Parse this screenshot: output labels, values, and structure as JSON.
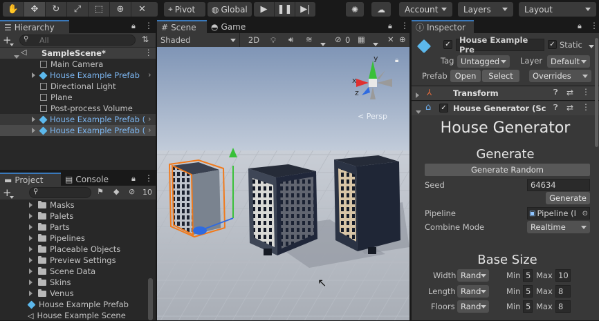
{
  "toolbar": {
    "pivot_label": "Pivot",
    "global_label": "Global",
    "account_label": "Account",
    "layers_label": "Layers",
    "layout_label": "Layout"
  },
  "hierarchy": {
    "tab_label": "Hierarchy",
    "search_placeholder": "All",
    "scene_name": "SampleScene*",
    "items": [
      {
        "label": "Main Camera",
        "prefab": false
      },
      {
        "label": "House Example Prefab",
        "prefab": true
      },
      {
        "label": "Directional Light",
        "prefab": false
      },
      {
        "label": "Plane",
        "prefab": false
      },
      {
        "label": "Post-process Volume",
        "prefab": false
      },
      {
        "label": "House Example Prefab (",
        "prefab": true
      },
      {
        "label": "House Example Prefab (",
        "prefab": true
      }
    ]
  },
  "project": {
    "tab_label": "Project",
    "console_tab_label": "Console",
    "hidden_count": "10",
    "folders": [
      "Masks",
      "Palets",
      "Parts",
      "Pipelines",
      "Placeable Objects",
      "Preview Settings",
      "Scene Data",
      "Skins",
      "Venus"
    ],
    "assets": [
      "House Example Prefab",
      "House Example Scene"
    ]
  },
  "scene": {
    "tab_label": "Scene",
    "game_tab_label": "Game",
    "shading_mode": "Shaded",
    "toggle_2d": "2D",
    "hidden_count": "0",
    "gizmo_x": "x",
    "gizmo_y": "y",
    "gizmo_z": "z",
    "persp_label": "< Persp"
  },
  "inspector": {
    "tab_label": "Inspector",
    "object_name": "House Example Pre",
    "static_label": "Static",
    "tag_label": "Tag",
    "tag_value": "Untagged",
    "layer_label": "Layer",
    "layer_value": "Default",
    "prefab_label": "Prefab",
    "open_label": "Open",
    "select_label": "Select",
    "overrides_label": "Overrides",
    "transform_label": "Transform",
    "component_label": "House Generator (Sc",
    "header_title": "House Generator",
    "generate_title": "Generate",
    "generate_random_label": "Generate Random",
    "seed_label": "Seed",
    "seed_value": "64634",
    "generate_label": "Generate",
    "pipeline_label": "Pipeline",
    "pipeline_value": "Pipeline (I",
    "combine_label": "Combine Mode",
    "combine_value": "Realtime",
    "base_size_title": "Base Size",
    "width_label": "Width",
    "length_label": "Length",
    "floors_label": "Floors",
    "rand_label": "Rand",
    "min_label": "Min",
    "max_label": "Max",
    "width_min": "5",
    "width_max": "10",
    "length_min": "5",
    "length_max": "8",
    "floors_min": "5",
    "floors_max": "8"
  },
  "colors": {
    "accent": "#3a79bb",
    "prefab_text": "#7cb6f1",
    "selection_orange": "#f07a1c"
  }
}
